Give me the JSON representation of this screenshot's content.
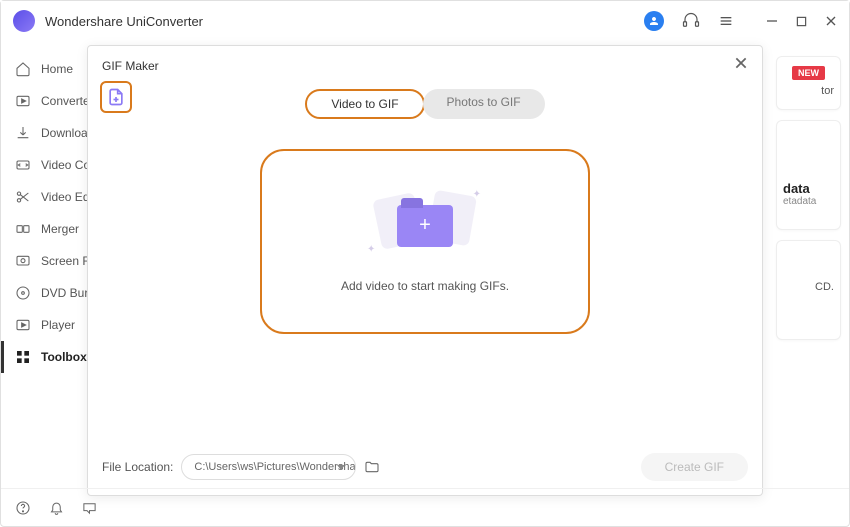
{
  "app": {
    "title": "Wondershare UniConverter"
  },
  "sidebar": {
    "items": [
      {
        "label": "Home"
      },
      {
        "label": "Converter"
      },
      {
        "label": "Downloader"
      },
      {
        "label": "Video Compressor"
      },
      {
        "label": "Video Editor"
      },
      {
        "label": "Merger"
      },
      {
        "label": "Screen Recorder"
      },
      {
        "label": "DVD Burner"
      },
      {
        "label": "Player"
      },
      {
        "label": "Toolbox"
      }
    ]
  },
  "peek": {
    "new_label": "NEW",
    "card1_suffix": "tor",
    "card2_title": "data",
    "card2_sub": "etadata",
    "card3_text": "CD."
  },
  "modal": {
    "title": "GIF Maker",
    "tabs": {
      "video": "Video to GIF",
      "photos": "Photos to GIF"
    },
    "drop_text": "Add video to start making GIFs.",
    "footer": {
      "label": "File Location:",
      "path": "C:\\Users\\ws\\Pictures\\Wondershare",
      "create": "Create GIF"
    }
  }
}
